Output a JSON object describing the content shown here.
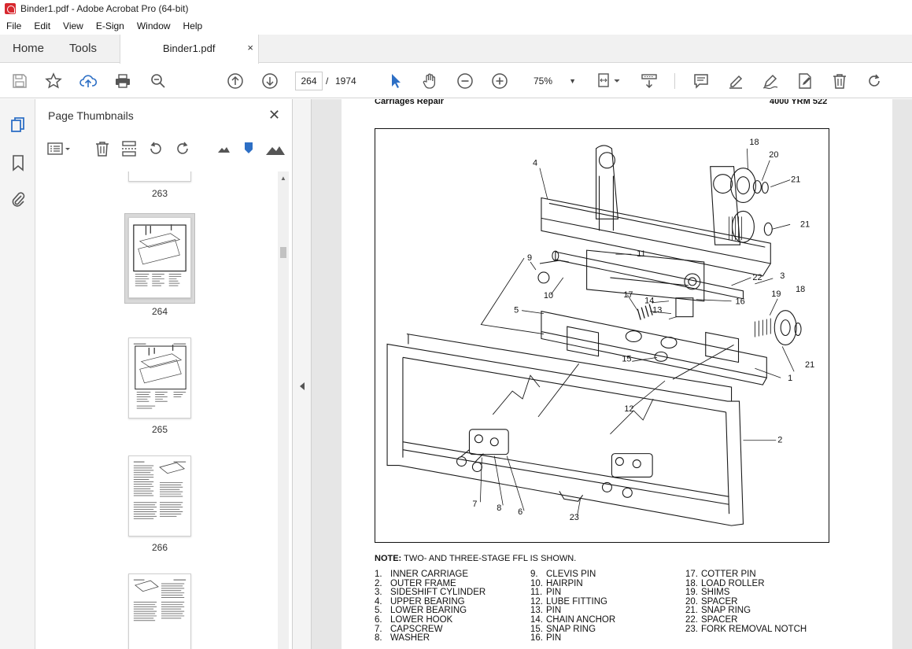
{
  "window": {
    "title": "Binder1.pdf - Adobe Acrobat Pro (64-bit)"
  },
  "menu": [
    "File",
    "Edit",
    "View",
    "E-Sign",
    "Window",
    "Help"
  ],
  "tabs": {
    "home": "Home",
    "tools": "Tools",
    "document": "Binder1.pdf",
    "close_glyph": "×"
  },
  "toolbar": {
    "page_current": "264",
    "page_separator": "/",
    "page_total": "1974",
    "zoom": "75%"
  },
  "panel": {
    "title": "Page Thumbnails",
    "close_glyph": "✕",
    "thumbnails": [
      {
        "label": "263"
      },
      {
        "label": "264",
        "selected": true
      },
      {
        "label": "265"
      },
      {
        "label": "266"
      },
      {
        "label": ""
      }
    ]
  },
  "document": {
    "header_left": "Carriages Repair",
    "header_right": "4000 YRM 522",
    "note_label": "NOTE:",
    "note_text": "TWO- AND THREE-STAGE FFL IS SHOWN.",
    "callouts": [
      "18",
      "20",
      "4",
      "21",
      "21",
      "9",
      "11",
      "22",
      "3",
      "10",
      "17",
      "14",
      "16",
      "19",
      "18",
      "13",
      "5",
      "15",
      "21",
      "1",
      "12",
      "2",
      "7",
      "8",
      "6",
      "23"
    ],
    "legend": [
      [
        {
          "n": "1.",
          "t": "INNER CARRIAGE"
        },
        {
          "n": "2.",
          "t": "OUTER FRAME"
        },
        {
          "n": "3.",
          "t": "SIDESHIFT CYLINDER"
        },
        {
          "n": "4.",
          "t": "UPPER BEARING"
        },
        {
          "n": "5.",
          "t": "LOWER BEARING"
        },
        {
          "n": "6.",
          "t": "LOWER HOOK"
        },
        {
          "n": "7.",
          "t": "CAPSCREW"
        },
        {
          "n": "8.",
          "t": "WASHER"
        }
      ],
      [
        {
          "n": "9.",
          "t": "CLEVIS PIN"
        },
        {
          "n": "10.",
          "t": "HAIRPIN"
        },
        {
          "n": "11.",
          "t": "PIN"
        },
        {
          "n": "12.",
          "t": "LUBE FITTING"
        },
        {
          "n": "13.",
          "t": "PIN"
        },
        {
          "n": "14.",
          "t": "CHAIN ANCHOR"
        },
        {
          "n": "15.",
          "t": "SNAP RING"
        },
        {
          "n": "16.",
          "t": "PIN"
        }
      ],
      [
        {
          "n": "17.",
          "t": "COTTER PIN"
        },
        {
          "n": "18.",
          "t": "LOAD ROLLER"
        },
        {
          "n": "19.",
          "t": "SHIMS"
        },
        {
          "n": "20.",
          "t": "SPACER"
        },
        {
          "n": "21.",
          "t": "SNAP RING"
        },
        {
          "n": "22.",
          "t": "SPACER"
        },
        {
          "n": "23.",
          "t": "FORK REMOVAL NOTCH"
        }
      ]
    ]
  },
  "colors": {
    "accent_blue": "#2d6fc5",
    "selected_thumb_bg": "#d9d9d9"
  }
}
